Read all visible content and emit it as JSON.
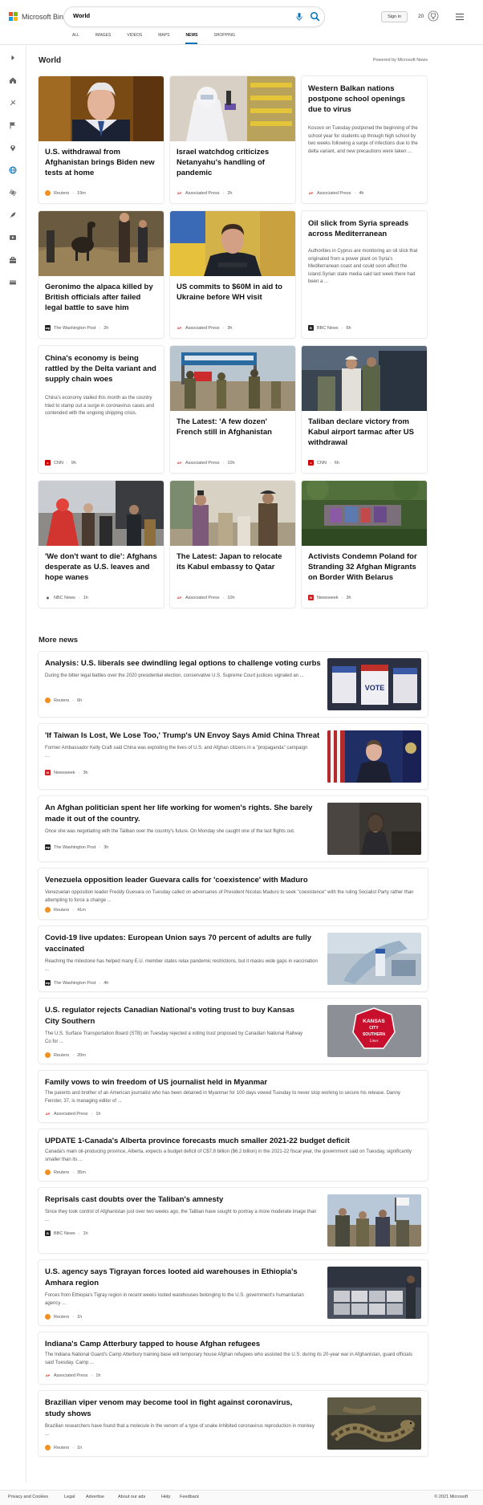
{
  "header": {
    "logo_text": "Microsoft Bing",
    "search_value": "World",
    "signin_label": "Sign in",
    "rewards_count": "20",
    "nav_tabs": [
      "ALL",
      "IMAGES",
      "VIDEOS",
      "MAPS",
      "NEWS",
      "SHOPPING"
    ],
    "active_tab": "NEWS"
  },
  "colors": {
    "accent": "#0071bc",
    "ms_red": "#f25022",
    "ms_green": "#7fba00",
    "ms_blue": "#00a4ef",
    "ms_yellow": "#ffb900"
  },
  "world": {
    "title": "World",
    "powered": "Powered by Microsoft News",
    "cards": [
      {
        "title": "U.S. withdrawal from Afghanistan brings Biden new tests at home",
        "source": "Reuters",
        "time": "19m",
        "logo": "reuters"
      },
      {
        "title": "Israel watchdog criticizes Netanyahu's handling of pandemic",
        "source": "Associated Press",
        "time": "2h",
        "logo": "ap"
      },
      {
        "title": "Western Balkan nations postpone school openings due to virus",
        "desc": "Kosovo on Tuesday postponed the beginning of the school year for students up through high school by two weeks following a surge of infections due to the delta variant, and new precautions were taken ...",
        "source": "Associated Press",
        "time": "4h",
        "logo": "ap"
      },
      {
        "title": "Geronimo the alpaca killed by British officials after failed legal battle to save him",
        "source": "The Washington Post",
        "time": "2h",
        "logo": "wapo"
      },
      {
        "title": "US commits to $60M in aid to Ukraine before WH visit",
        "source": "Associated Press",
        "time": "3h",
        "logo": "ap"
      },
      {
        "title": "Oil slick from Syria spreads across Mediterranean",
        "desc": "Authorities in Cyprus are monitoring an oil slick that originated from a power plant on Syria's Mediterranean coast and could soon affect the island.Syrian state media said last week there had been a ...",
        "source": "BBC News",
        "time": "6h",
        "logo": "bbc"
      },
      {
        "title": "China's economy is being rattled by the Delta variant and supply chain woes",
        "desc": "China's economy stalled this month as the country tried to stamp out a surge in coronavirus cases and contended with the ongoing shipping crisis.",
        "source": "CNN",
        "time": "9h",
        "logo": "cnn"
      },
      {
        "title": "The Latest: 'A few dozen' French still in Afghanistan",
        "source": "Associated Press",
        "time": "10h",
        "logo": "ap"
      },
      {
        "title": "Taliban declare victory from Kabul airport tarmac after US withdrawal",
        "source": "CNN",
        "time": "6h",
        "logo": "cnn"
      },
      {
        "title": "'We don't want to die': Afghans desperate as U.S. leaves and hope wanes",
        "source": "NBC News",
        "time": "1h",
        "logo": "nbc"
      },
      {
        "title": "The Latest: Japan to relocate its Kabul embassy to Qatar",
        "source": "Associated Press",
        "time": "10h",
        "logo": "ap"
      },
      {
        "title": "Activists Condemn Poland for Stranding 32 Afghan Migrants on Border With Belarus",
        "source": "Newsweek",
        "time": "3h",
        "logo": "newsweek"
      }
    ]
  },
  "more": {
    "title": "More news",
    "items": [
      {
        "title": "Analysis: U.S. liberals see dwindling legal options to challenge voting curbs",
        "desc": "During the bitter legal battles over the 2020 presidential election, conservative U.S. Supreme Court justices signaled an ...",
        "source": "Reuters",
        "time": "6h",
        "logo": "reuters"
      },
      {
        "title": "'If Taiwan Is Lost, We Lose Too,' Trump's UN Envoy Says Amid China Threat",
        "desc": "Former Ambassador Kelly Craft said China was exploiting the lives of U.S. and Afghan citizens in a \"propaganda\" campaign ...",
        "source": "Newsweek",
        "time": "3h",
        "logo": "newsweek"
      },
      {
        "title": "An Afghan politician spent her life working for women's rights. She barely made it out of the country.",
        "desc": "Once she was negotiating with the Taliban over the country's future. On Monday she caught one of the last flights out.",
        "source": "The Washington Post",
        "time": "3h",
        "logo": "wapo"
      },
      {
        "title": "Venezuela opposition leader Guevara calls for 'coexistence' with Maduro",
        "desc": "Venezuelan opposition leader Freddy Guevara on Tuesday called on adversaries of President Nicolas Maduro to seek \"coexistence\" with the ruling Socialist Party rather than attempting to force a change ...",
        "source": "Reuters",
        "time": "41m",
        "logo": "reuters"
      },
      {
        "title": "Covid-19 live updates: European Union says 70 percent of adults are fully vaccinated",
        "desc": "Reaching the milestone has helped many E.U. member states relax pandemic restrictions, but it masks wide gaps in vaccination ...",
        "source": "The Washington Post",
        "time": "4h",
        "logo": "wapo"
      },
      {
        "title": "U.S. regulator rejects Canadian National's voting trust to buy Kansas City Southern",
        "desc": "The U.S. Surface Transportation Board (STB) on Tuesday rejected a voting trust proposed by Canadian National Railway Co for ...",
        "source": "Reuters",
        "time": "20m",
        "logo": "reuters"
      },
      {
        "title": "Family vows to win freedom of US journalist held in Myanmar",
        "desc": "The parents and brother of an American journalist who has been detained in Myanmar for 100 days vowed Tuesday to never stop working to secure his release. Danny Fenster, 37, is managing editor of ...",
        "source": "Associated Press",
        "time": "1h",
        "logo": "ap"
      },
      {
        "title": "UPDATE 1-Canada's Alberta province forecasts much smaller 2021-22 budget deficit",
        "desc": "Canada's main oil-producing province, Alberta, expects a budget deficit of C$7.8 billion ($6.2 billion) in the 2021-22 fiscal year, the government said on Tuesday, significantly smaller than its ...",
        "source": "Reuters",
        "time": "35m",
        "logo": "reuters"
      },
      {
        "title": "Reprisals cast doubts over the Taliban's amnesty",
        "desc": "Since they took control of Afghanistan just over two weeks ago, the Taliban have sought to portray a more moderate image than ...",
        "source": "BBC News",
        "time": "1h",
        "logo": "bbc"
      },
      {
        "title": "U.S. agency says Tigrayan forces looted aid warehouses in Ethiopia's Amhara region",
        "desc": "Forces from Ethiopia's Tigray region in recent weeks looted warehouses belonging to the U.S. government's humanitarian agency ...",
        "source": "Reuters",
        "time": "1h",
        "logo": "reuters"
      },
      {
        "title": "Indiana's Camp Atterbury tapped to house Afghan refugees",
        "desc": "The Indiana National Guard's Camp Atterbury training base will temporary house Afghan refugees who assisted the U.S. during its 20-year war in Afghanistan, guard officials said Tuesday. Camp ...",
        "source": "Associated Press",
        "time": "1h",
        "logo": "ap"
      },
      {
        "title": "Brazilian viper venom may become tool in fight against coronavirus, study shows",
        "desc": "Brazilian researchers have found that a molecule in the venom of a type of snake inhibited coronavirus reproduction in monkey ...",
        "source": "Reuters",
        "time": "1h",
        "logo": "reuters"
      }
    ],
    "sign_text": {
      "line1": "KANSAS",
      "line2": "CITY",
      "line3": "SOUTHERN",
      "line4": "Lines"
    },
    "vote_text": "VOTE"
  },
  "footer": {
    "links": [
      "Privacy and Cookies",
      "Legal",
      "Advertise",
      "About our ads",
      "Help",
      "Feedback"
    ],
    "copyright": "© 2021 Microsoft"
  }
}
